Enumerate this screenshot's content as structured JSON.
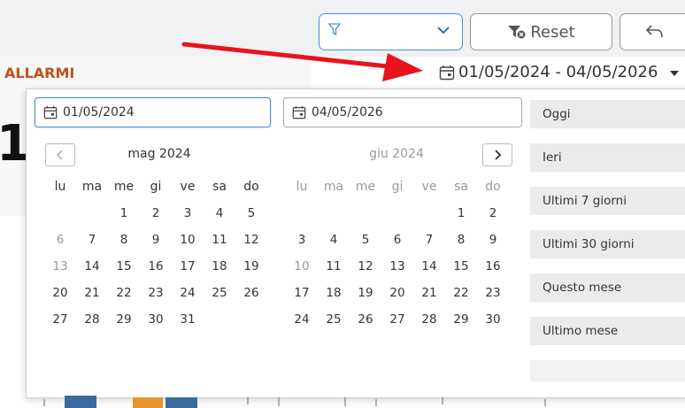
{
  "toolbar": {
    "reset_label": "Reset"
  },
  "header": {
    "section_title": "ALLARMI",
    "date_range": "01/05/2024 - 04/05/2026",
    "big_value": "1"
  },
  "picker": {
    "start_date": "01/05/2024",
    "end_date": "04/05/2026",
    "weekdays": [
      "lu",
      "ma",
      "me",
      "gi",
      "ve",
      "sa",
      "do"
    ],
    "month1": {
      "title": "mag 2024",
      "days": [
        "",
        "",
        "1",
        "2",
        "3",
        "4",
        "5",
        "6",
        "7",
        "8",
        "9",
        "10",
        "11",
        "12",
        "13",
        "14",
        "15",
        "16",
        "17",
        "18",
        "19",
        "20",
        "21",
        "22",
        "23",
        "24",
        "25",
        "26",
        "27",
        "28",
        "29",
        "30",
        "31",
        "",
        ""
      ]
    },
    "month2": {
      "title": "giu 2024",
      "days": [
        "",
        "",
        "",
        "",
        "",
        "1",
        "2",
        "3",
        "4",
        "5",
        "6",
        "7",
        "8",
        "9",
        "10",
        "11",
        "12",
        "13",
        "14",
        "15",
        "16",
        "17",
        "18",
        "19",
        "20",
        "21",
        "22",
        "23",
        "24",
        "25",
        "26",
        "27",
        "28",
        "29",
        "30"
      ]
    },
    "ranges": [
      "Oggi",
      "Ieri",
      "Ultimi 7 giorni",
      "Ultimi 30 giorni",
      "Questo mese",
      "Ultimo mese"
    ]
  },
  "colors": {
    "accent": "#4a90d9",
    "section_title": "#c0531b",
    "arrow": "#e8141c"
  }
}
